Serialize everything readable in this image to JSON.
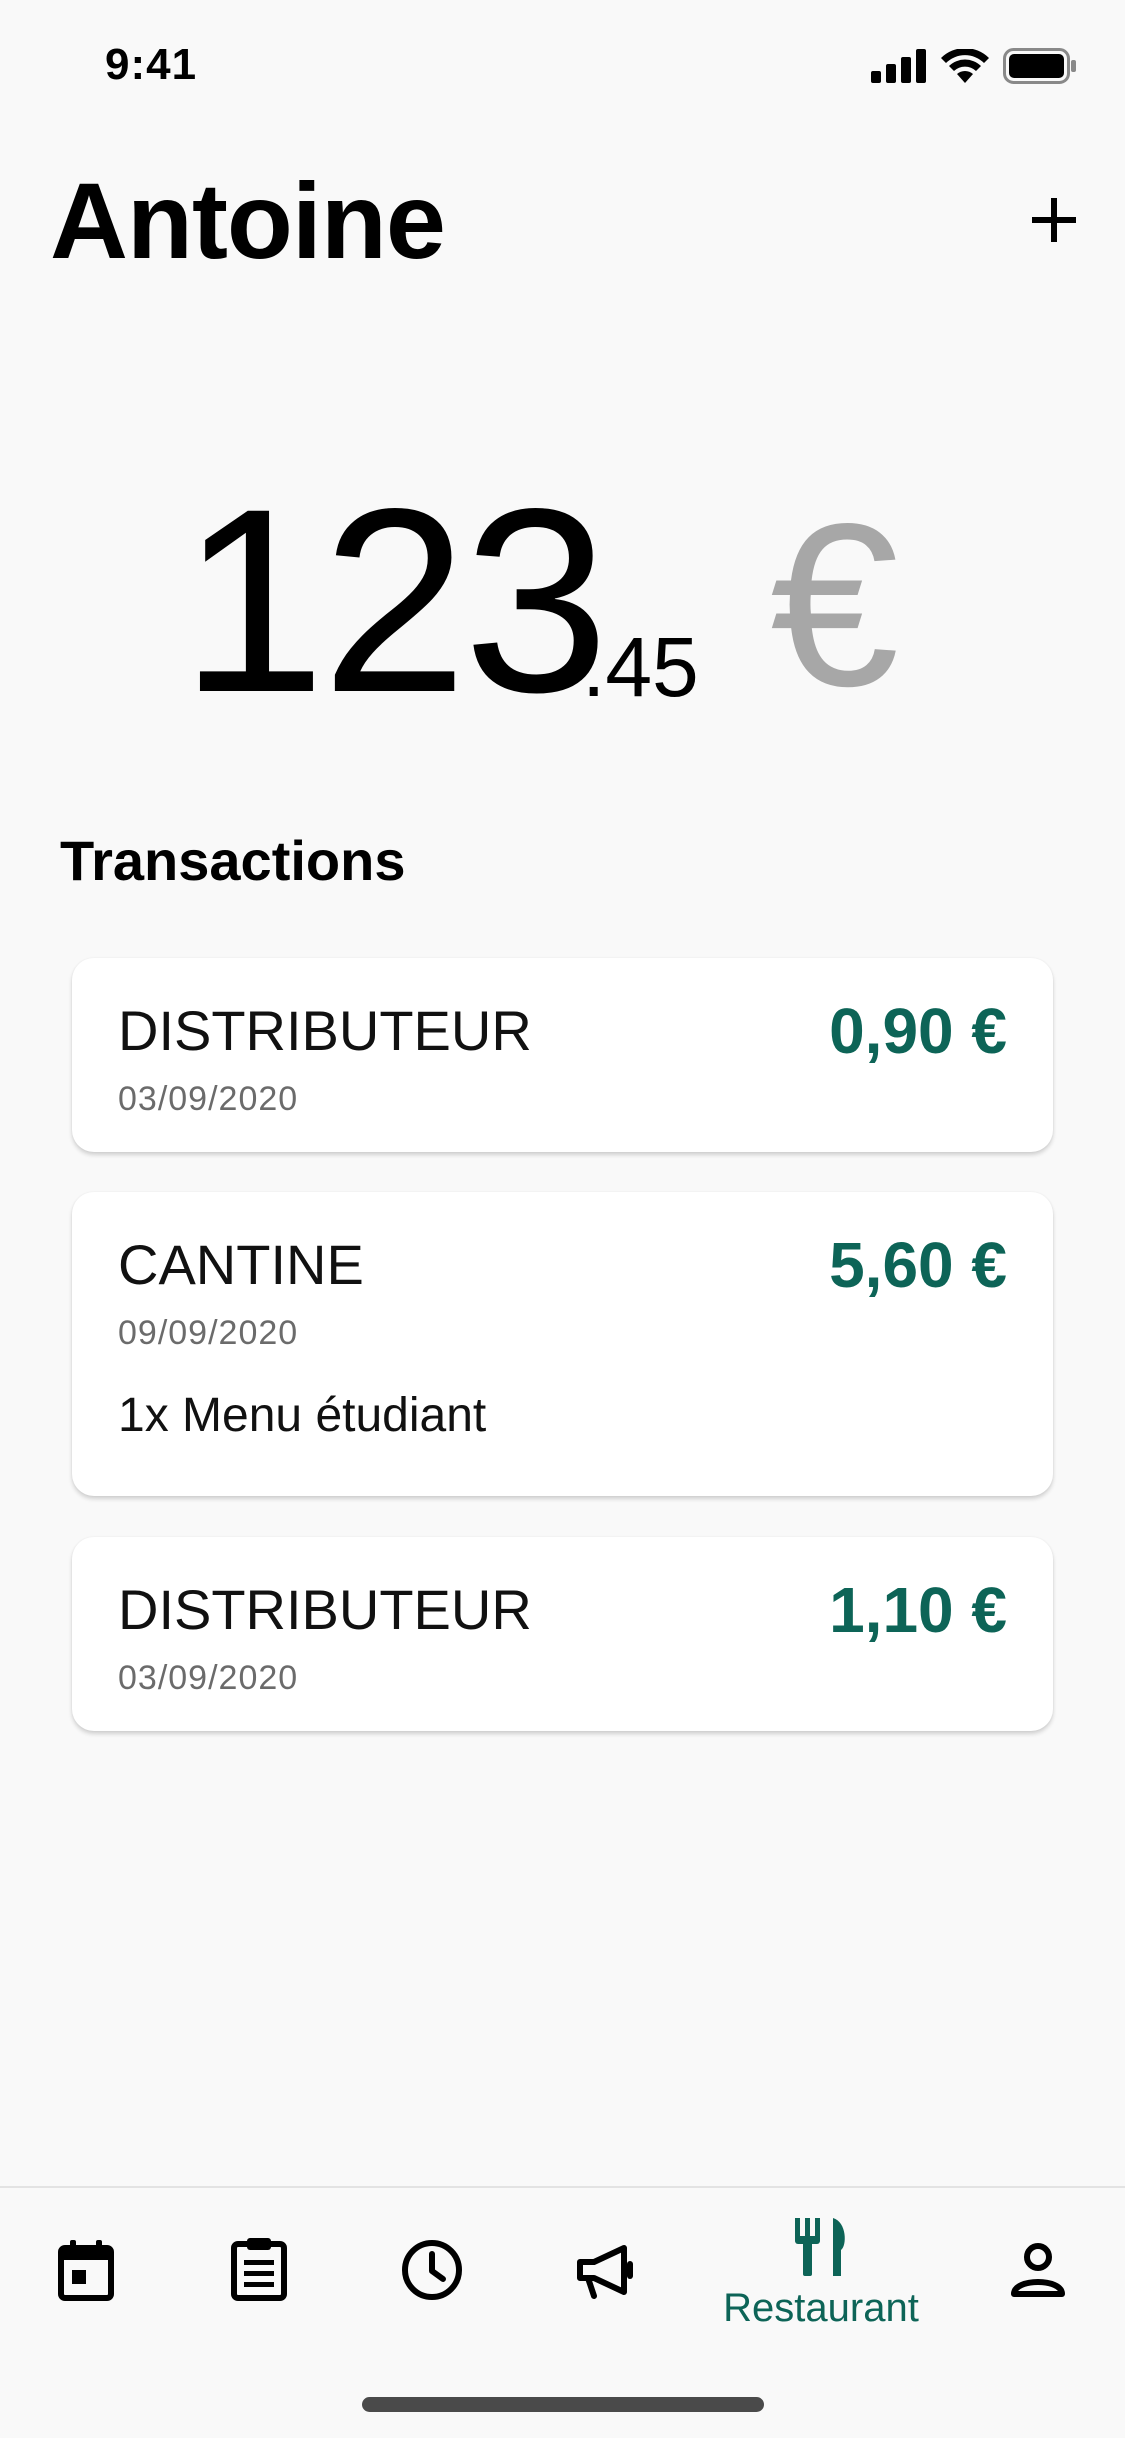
{
  "status_bar": {
    "time": "9:41"
  },
  "header": {
    "title": "Antoine",
    "add_icon": "plus-icon"
  },
  "balance": {
    "integer": "123",
    "decimal": ".45",
    "currency": "€"
  },
  "transactions": {
    "heading": "Transactions",
    "items": [
      {
        "name": "DISTRIBUTEUR",
        "date": "03/09/2020",
        "amount": "0,90 €",
        "detail": ""
      },
      {
        "name": "CANTINE",
        "date": "09/09/2020",
        "amount": "5,60 €",
        "detail": "1x Menu étudiant"
      },
      {
        "name": "DISTRIBUTEUR",
        "date": "03/09/2020",
        "amount": "1,10 €",
        "detail": ""
      }
    ]
  },
  "bottom_nav": {
    "items": [
      {
        "icon": "calendar-icon",
        "label": ""
      },
      {
        "icon": "clipboard-icon",
        "label": ""
      },
      {
        "icon": "clock-icon",
        "label": ""
      },
      {
        "icon": "megaphone-icon",
        "label": ""
      },
      {
        "icon": "fork-knife-icon",
        "label": "Restaurant",
        "active": true
      },
      {
        "icon": "user-icon",
        "label": ""
      }
    ]
  },
  "colors": {
    "accent": "#0d6457",
    "currency_gray": "#a7a7a7",
    "background": "#f9f9f9"
  }
}
